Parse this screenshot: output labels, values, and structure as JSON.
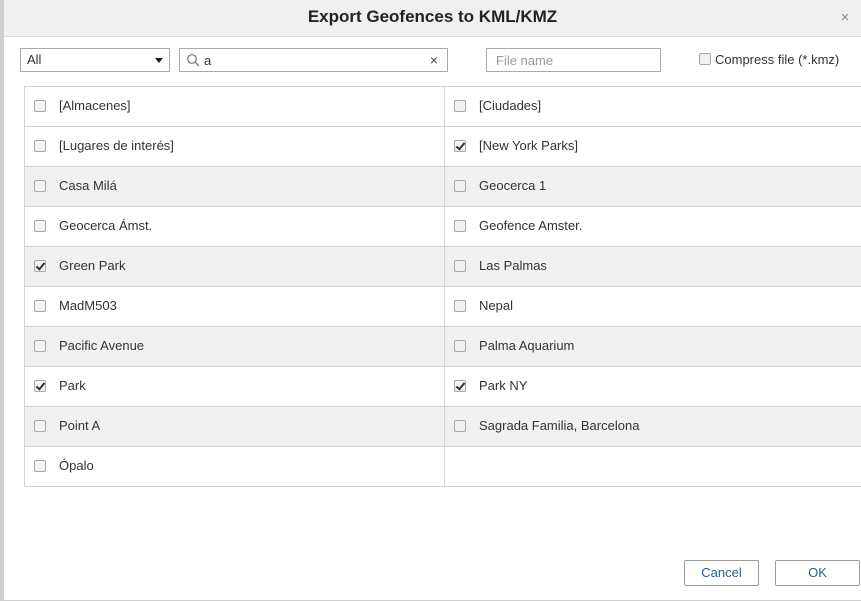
{
  "dialog": {
    "title": "Export Geofences to KML/KMZ",
    "close_symbol": "×"
  },
  "toolbar": {
    "group_filter": {
      "selected": "All"
    },
    "search": {
      "value": "a",
      "clear_symbol": "×"
    },
    "file_name": {
      "value": "",
      "placeholder": "File name"
    },
    "compress": {
      "label": "Compress file (*.kmz)",
      "checked": false
    }
  },
  "geofences": [
    {
      "label": "[Almacenes]",
      "checked": false
    },
    {
      "label": "[Ciudades]",
      "checked": false
    },
    {
      "label": "[Lugares de interés]",
      "checked": false
    },
    {
      "label": "[New York Parks]",
      "checked": true
    },
    {
      "label": "Casa Milá",
      "checked": false
    },
    {
      "label": "Geocerca 1",
      "checked": false
    },
    {
      "label": "Geocerca Ámst.",
      "checked": false
    },
    {
      "label": "Geofence Amster.",
      "checked": false
    },
    {
      "label": "Green Park",
      "checked": true
    },
    {
      "label": "Las Palmas",
      "checked": false
    },
    {
      "label": "MadM503",
      "checked": false
    },
    {
      "label": "Nepal",
      "checked": false
    },
    {
      "label": "Pacific Avenue",
      "checked": false
    },
    {
      "label": "Palma Aquarium",
      "checked": false
    },
    {
      "label": "Park",
      "checked": true
    },
    {
      "label": "Park NY",
      "checked": true
    },
    {
      "label": "Point A",
      "checked": false
    },
    {
      "label": "Sagrada Familia, Barcelona",
      "checked": false
    },
    {
      "label": "Ópalo",
      "checked": false
    }
  ],
  "buttons": {
    "cancel": "Cancel",
    "ok": "OK"
  },
  "icons": {
    "search": "search-icon",
    "clear": "close-icon",
    "dropdown": "chevron-down-icon",
    "close": "close-icon"
  },
  "colors": {
    "title_bar": "#f0f0f0",
    "row_shade": "#f1f1f1",
    "button_text": "#2a5d8f"
  }
}
